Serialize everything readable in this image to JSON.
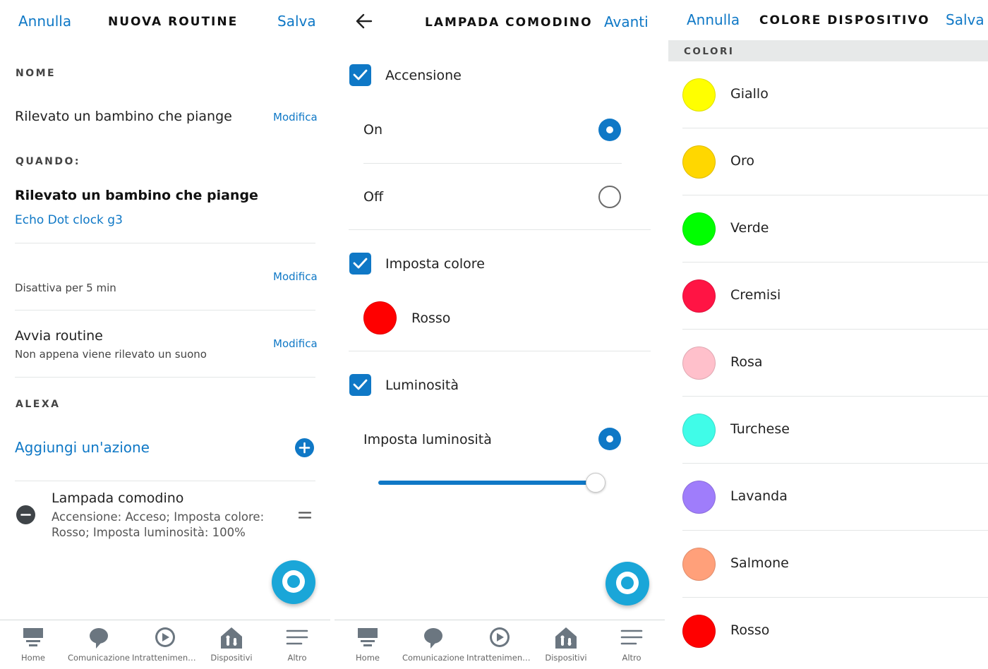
{
  "panel1": {
    "cancel": "Annulla",
    "title": "NUOVA ROUTINE",
    "save": "Salva",
    "name_section": "NOME",
    "name_value": "Rilevato un bambino che piange",
    "modifica": "Modifica",
    "when_section": "QUANDO:",
    "trigger_title": "Rilevato un bambino che piange",
    "trigger_device": "Echo Dot clock g3",
    "snooze_text": "Disattiva per 5 min",
    "start_title": "Avvia routine",
    "start_sub": "Non appena viene rilevato un suono",
    "alexa_section": "ALEXA",
    "add_action": "Aggiungi un'azione",
    "action_title": "Lampada comodino",
    "action_desc_1": "Accensione: Acceso; Imposta colore:",
    "action_desc_2": "Rosso; Imposta luminosità: 100%"
  },
  "panel2": {
    "title": "LAMPADA COMODINO",
    "next": "Avanti",
    "power_label": "Accensione",
    "on_label": "On",
    "off_label": "Off",
    "color_label": "Imposta colore",
    "color_value": "Rosso",
    "color_hex": "#ff0000",
    "brightness_label": "Luminosità",
    "set_brightness": "Imposta luminosità",
    "brightness_level": 1.0
  },
  "panel3": {
    "cancel": "Annulla",
    "title": "COLORE DISPOSITIVO",
    "save": "Salva",
    "section": "COLORI",
    "colors": [
      {
        "name": "Giallo",
        "hex": "#ffff00"
      },
      {
        "name": "Oro",
        "hex": "#ffd700"
      },
      {
        "name": "Verde",
        "hex": "#00ff00"
      },
      {
        "name": "Cremisi",
        "hex": "#ff1444"
      },
      {
        "name": "Rosa",
        "hex": "#ffc0cb"
      },
      {
        "name": "Turchese",
        "hex": "#40fce8"
      },
      {
        "name": "Lavanda",
        "hex": "#9f7dfb"
      },
      {
        "name": "Salmone",
        "hex": "#ffa07a"
      },
      {
        "name": "Rosso",
        "hex": "#ff0000"
      }
    ]
  },
  "nav": {
    "items": [
      "Home",
      "Comunicazione",
      "Intratteniment...",
      "Dispositivi",
      "Altro"
    ]
  },
  "colors": {
    "accent": "#0f78c6",
    "alexa": "#1aa6d8"
  }
}
